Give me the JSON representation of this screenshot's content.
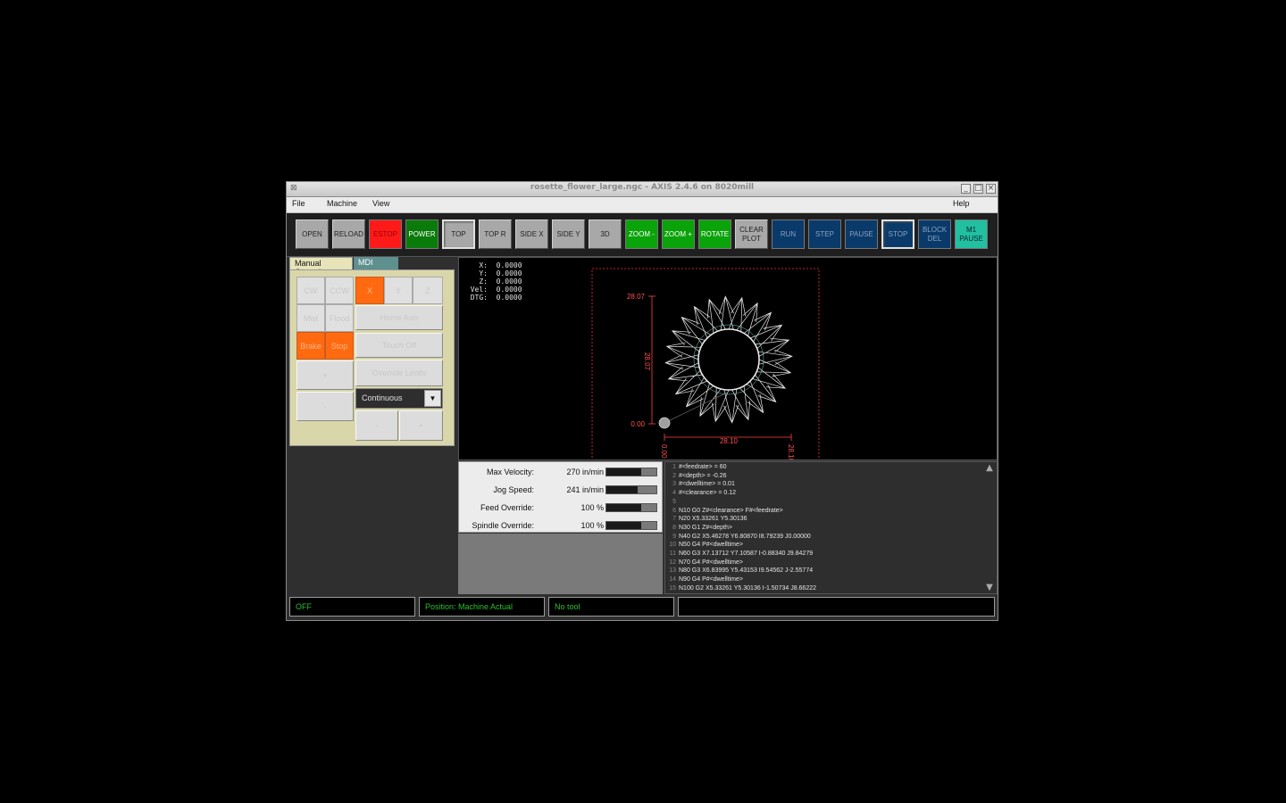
{
  "window": {
    "title": "rosette_flower_large.ngc - AXIS 2.4.6 on 8020mill"
  },
  "menubar": {
    "file": "File",
    "machine": "Machine",
    "view": "View",
    "help": "Help"
  },
  "toolbar": [
    {
      "id": "open",
      "label": "OPEN",
      "style": "gray"
    },
    {
      "id": "reload",
      "label": "RELOAD",
      "style": "gray"
    },
    {
      "id": "estop",
      "label": "ESTOP",
      "style": "red"
    },
    {
      "id": "power",
      "label": "POWER",
      "style": "green"
    },
    {
      "id": "top",
      "label": "TOP",
      "style": "gray pressed"
    },
    {
      "id": "top-r",
      "label": "TOP R",
      "style": "gray"
    },
    {
      "id": "side-x",
      "label": "SIDE X",
      "style": "gray"
    },
    {
      "id": "side-y",
      "label": "SIDE Y",
      "style": "gray"
    },
    {
      "id": "3d",
      "label": "3D",
      "style": "gray"
    },
    {
      "id": "zoom-minus",
      "label": "ZOOM -",
      "style": "brightgreen"
    },
    {
      "id": "zoom-plus",
      "label": "ZOOM +",
      "style": "brightgreen"
    },
    {
      "id": "rotate",
      "label": "ROTATE",
      "style": "brightgreen"
    },
    {
      "id": "clear-plot",
      "label": "CLEAR PLOT",
      "style": "gray"
    },
    {
      "id": "run",
      "label": "RUN",
      "style": "blue"
    },
    {
      "id": "step",
      "label": "STEP",
      "style": "blue"
    },
    {
      "id": "pause",
      "label": "PAUSE",
      "style": "blue"
    },
    {
      "id": "stop",
      "label": "STOP",
      "style": "blue pressed"
    },
    {
      "id": "block-del",
      "label": "BLOCK DEL",
      "style": "blue"
    },
    {
      "id": "m1-pause",
      "label": "M1 PAUSE",
      "style": "teal"
    }
  ],
  "tabs": {
    "manual": "Manual Control",
    "mdi": "MDI"
  },
  "manual": {
    "cw": "CW",
    "ccw": "CCW",
    "x": "X",
    "y": "Y",
    "z": "Z",
    "mist": "Mist",
    "flood": "Flood",
    "home_axis": "Home Axis",
    "brake": "Brake",
    "stop": "Stop",
    "touch_off": "Touch Off",
    "plus": "+",
    "minus": "-",
    "override_limits": "Override Limits",
    "jog_mode": "Continuous",
    "jog_minus": "-",
    "jog_plus": "+"
  },
  "dro": {
    "x_label": "X:",
    "x": "0.0000",
    "y_label": "Y:",
    "y": "0.0000",
    "z_label": "Z:",
    "z": "0.0000",
    "vel_label": "Vel:",
    "vel": "0.0000",
    "dtg_label": "DTG:",
    "dtg": "0.0000"
  },
  "plot": {
    "dim_top": "28.07",
    "dim_height": "28.07",
    "dim_origin_y": "0.00",
    "dim_width": "28.10",
    "dim_origin_x": "0.00",
    "dim_right": "28.10",
    "colors": {
      "dim": "#ff4040",
      "path": "#e8e8e8",
      "tool": "#9a9a9a"
    }
  },
  "sliders": [
    {
      "label": "Max Velocity:",
      "value": "270 in/min",
      "fraction": 0.7
    },
    {
      "label": "Jog Speed:",
      "value": "241 in/min",
      "fraction": 0.62
    },
    {
      "label": "Feed Override:",
      "value": "100 %",
      "fraction": 0.7
    },
    {
      "label": "Spindle Override:",
      "value": "100 %",
      "fraction": 0.7
    }
  ],
  "gcode": [
    {
      "n": "1",
      "text": "#<feedrate> = 60"
    },
    {
      "n": "2",
      "text": "#<depth> = -0.26"
    },
    {
      "n": "3",
      "text": "#<dwelltime> = 0.01"
    },
    {
      "n": "4",
      "text": "#<clearance> = 0.12"
    },
    {
      "n": "5",
      "text": ""
    },
    {
      "n": "6",
      "text": "N10 G0 Z#<clearance> F#<feedrate>"
    },
    {
      "n": "7",
      "text": "N20 X5.33261 Y5.30136"
    },
    {
      "n": "8",
      "text": "N30 G1 Z#<depth>"
    },
    {
      "n": "9",
      "text": "N40 G2 X5.46278 Y6.80870 I8.79239 J0.00000"
    },
    {
      "n": "10",
      "text": "N50 G4 P#<dwelltime>"
    },
    {
      "n": "11",
      "text": "N60 G3 X7.13712 Y7.10587 I-0.88340 J9.84279"
    },
    {
      "n": "12",
      "text": "N70 G4 P#<dwelltime>"
    },
    {
      "n": "13",
      "text": "N80 G3 X6.83995 Y5.43153 I9.54562 J-2.55774"
    },
    {
      "n": "14",
      "text": "N90 G4 P#<dwelltime>"
    },
    {
      "n": "15",
      "text": "N100 G2 X5.33261 Y5.30136 I-1.50734 J8.66222"
    }
  ],
  "status": {
    "state": "OFF",
    "position": "Position: Machine Actual",
    "tool": "No tool",
    "extra": ""
  }
}
